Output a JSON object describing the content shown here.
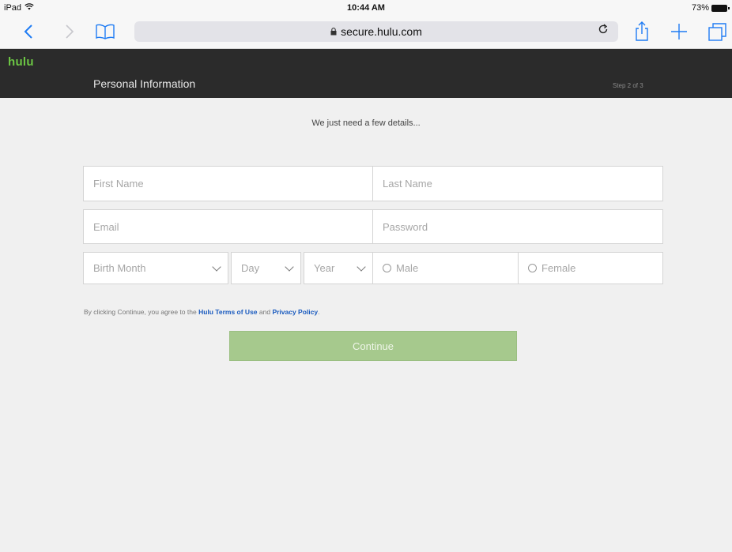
{
  "status_bar": {
    "device": "iPad",
    "time": "10:44 AM",
    "battery": "73%"
  },
  "browser": {
    "url": "secure.hulu.com",
    "icons": [
      "back-icon",
      "forward-icon",
      "bookmarks-icon",
      "lock-icon",
      "reload-icon",
      "share-icon",
      "new-tab-icon",
      "tabs-icon"
    ]
  },
  "header": {
    "logo": "hulu",
    "title": "Personal Information",
    "step": "Step 2 of 3"
  },
  "form": {
    "intro": "We just need a few details...",
    "first_name_placeholder": "First Name",
    "last_name_placeholder": "Last Name",
    "email_placeholder": "Email",
    "password_placeholder": "Password",
    "birth_month": "Birth Month",
    "day": "Day",
    "year": "Year",
    "male": "Male",
    "female": "Female",
    "terms_prefix": "By clicking Continue, you agree to the ",
    "terms_link": "Hulu Terms of Use",
    "terms_and": " and ",
    "privacy_link": "Privacy Policy",
    "terms_suffix": ".",
    "continue_label": "Continue"
  },
  "colors": {
    "hulu_green": "#6cc644",
    "header_bg": "#2b2b2b",
    "continue_bg": "#a6c98d",
    "link_blue": "#1a5bbf",
    "safari_blue": "#1f7cf4"
  }
}
